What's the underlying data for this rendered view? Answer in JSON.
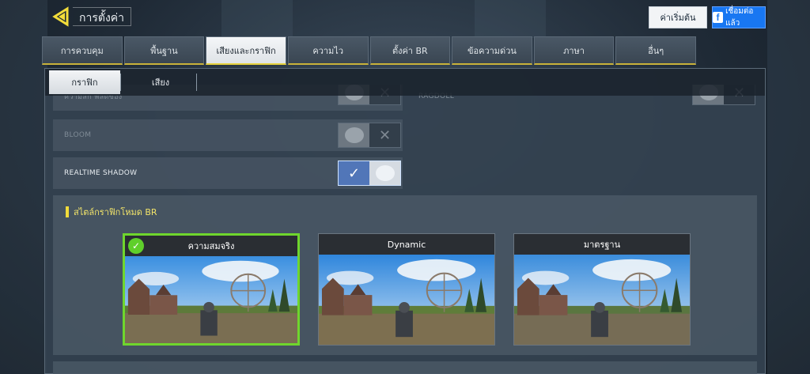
{
  "header": {
    "title": "การตั้งค่า",
    "reset_label": "ค่าเริ่มต้น",
    "facebook_label": "เชื่อมต่อแล้ว",
    "facebook_logo": "f"
  },
  "tabs": [
    {
      "label": "การควบคุม"
    },
    {
      "label": "พื้นฐาน"
    },
    {
      "label": "เสียงและกราฟิก",
      "active": true
    },
    {
      "label": "ความไว"
    },
    {
      "label": "ตั้งค่า BR"
    },
    {
      "label": "ข้อความด่วน"
    },
    {
      "label": "ภาษา"
    },
    {
      "label": "อื่นๆ"
    }
  ],
  "subtabs": [
    {
      "label": "กราฟิก",
      "active": true
    },
    {
      "label": "เสียง"
    }
  ],
  "settings": {
    "row1_label": "ความลึก ฟิลด์ของ",
    "row1_right_label": "RAGDOLL",
    "bloom_label": "BLOOM",
    "realtime_shadow_label": "REALTIME SHADOW",
    "realtime_shadow_on": true,
    "bloom_on": false
  },
  "br_style": {
    "title": "สไตล์กราฟิกโหมด BR",
    "options": [
      {
        "label": "ความสมจริง",
        "selected": true
      },
      {
        "label": "Dynamic",
        "selected": false
      },
      {
        "label": "มาตรฐาน",
        "selected": false
      }
    ]
  },
  "colors": {
    "accent_yellow": "#e6d23e",
    "selected_green": "#6fd62d",
    "toggle_on_blue": "#5176b8",
    "facebook_blue": "#1877f2"
  }
}
